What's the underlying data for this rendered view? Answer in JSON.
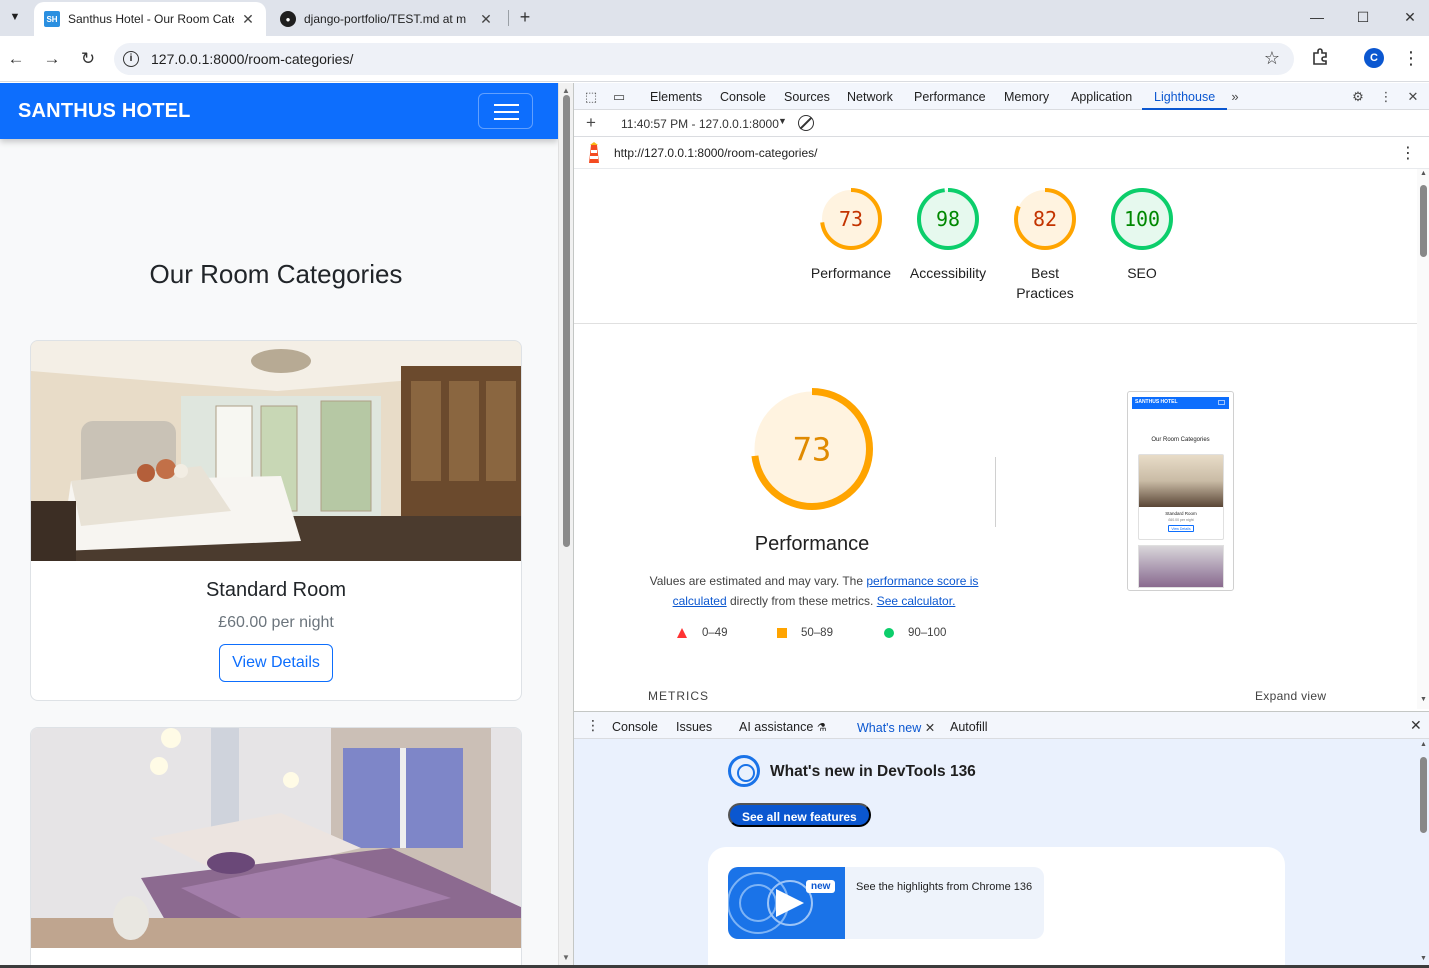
{
  "browser": {
    "tabs": [
      {
        "favicon": "SH",
        "title": "Santhus Hotel - Our Room Cate",
        "active": true
      },
      {
        "favicon": "github-icon",
        "title": "django-portfolio/TEST.md at m",
        "active": false
      }
    ],
    "url": "127.0.0.1:8000/room-categories/",
    "profile_initial": "C"
  },
  "site": {
    "brand": "SANTHUS HOTEL",
    "heading": "Our Room Categories",
    "rooms": [
      {
        "name": "Standard Room",
        "price": "£60.00 per night",
        "button": "View Details"
      }
    ],
    "colors": {
      "nav": "#0d6efd",
      "button_border": "#0d6efd"
    }
  },
  "devtools": {
    "tabs": [
      "Elements",
      "Console",
      "Sources",
      "Network",
      "Performance",
      "Memory",
      "Application",
      "Lighthouse"
    ],
    "active_tab": "Lighthouse",
    "run_label": "11:40:57 PM - 127.0.0.1:8000",
    "report_url": "http://127.0.0.1:8000/room-categories/",
    "scores": [
      {
        "label": "Performance",
        "value": "73",
        "fraction": 0.73,
        "color": "#ffa400",
        "fill": "#fff3e0",
        "text_color": "#c33300"
      },
      {
        "label": "Accessibility",
        "value": "98",
        "fraction": 0.98,
        "color": "#0cce6b",
        "fill": "#e6f9ee",
        "text_color": "#008800"
      },
      {
        "label": "Best Practices",
        "label_line1": "Best",
        "label_line2": "Practices",
        "value": "82",
        "fraction": 0.82,
        "color": "#ffa400",
        "fill": "#fff3e0",
        "text_color": "#c33300"
      },
      {
        "label": "SEO",
        "value": "100",
        "fraction": 1.0,
        "color": "#0cce6b",
        "fill": "#e6f9ee",
        "text_color": "#008800"
      }
    ],
    "perf": {
      "value": "73",
      "fraction": 0.73,
      "title": "Performance",
      "desc_pre": "Values are estimated and may vary. The ",
      "link1": "performance score is calculated",
      "desc_mid": " directly from these metrics. ",
      "link2": "See calculator."
    },
    "legend": [
      {
        "shape": "triangle",
        "color": "#ff3333",
        "range": "0–49"
      },
      {
        "shape": "square",
        "color": "#ffa400",
        "range": "50–89"
      },
      {
        "shape": "circle",
        "color": "#0cce6b",
        "range": "90–100"
      }
    ],
    "metrics_label": "METRICS",
    "expand_view": "Expand view",
    "thumbnail": {
      "brand": "SANTHUS HOTEL",
      "heading": "Our Room Categories",
      "room": "Standard Room",
      "price": "£60.00 per night",
      "button": "View Details"
    },
    "drawer": {
      "tabs": [
        "Console",
        "Issues",
        "AI assistance",
        "What's new",
        "Autofill"
      ],
      "active_tab": "What's new",
      "title": "What's new in DevTools 136",
      "see_all": "See all new features",
      "badge": "new",
      "highlight": "See the highlights from Chrome 136"
    }
  }
}
